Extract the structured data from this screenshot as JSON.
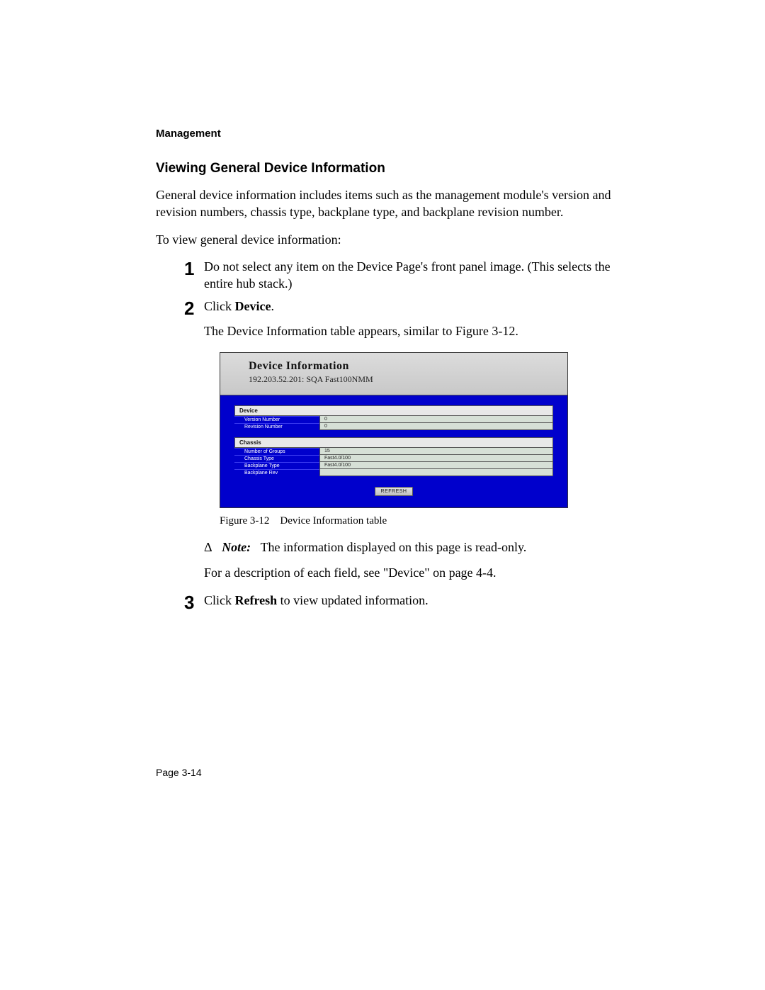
{
  "chapter_label": "Management",
  "section_title": "Viewing General Device Information",
  "intro": "General device information includes items such as the management module's version and revision numbers, chassis type, backplane type, and backplane revision number.",
  "lead": "To view general device information:",
  "steps": {
    "s1": {
      "num": "1",
      "text": "Do not select any item on the Device Page's front panel image. (This selects the entire hub stack.)"
    },
    "s2": {
      "num": "2",
      "pre": "Click ",
      "bold": "Device",
      "post": ".",
      "after": "The Device Information table appears, similar to Figure 3-12."
    },
    "s3": {
      "num": "3",
      "pre": "Click ",
      "bold": "Refresh",
      "post": " to view updated information."
    }
  },
  "figure": {
    "title": "Device Information",
    "subtitle": "192.203.52.201: SQA Fast100NMM",
    "device": {
      "header": "Device",
      "rows": [
        {
          "label": "Version Number",
          "value": "0"
        },
        {
          "label": "Revision Number",
          "value": "0"
        }
      ]
    },
    "chassis": {
      "header": "Chassis",
      "rows": [
        {
          "label": "Number of Groups",
          "value": "15"
        },
        {
          "label": "Chassis Type",
          "value": "Fast4.0/100"
        },
        {
          "label": "Backplane Type",
          "value": "Fast4.0/100"
        },
        {
          "label": "Backplane Rev",
          "value": ""
        }
      ]
    },
    "refresh_label": "REFRESH"
  },
  "caption": "Figure 3-12 Device Information table",
  "note": {
    "delta": "Δ",
    "label": "Note:",
    "text": "The information displayed on this page is read-only."
  },
  "crossref": "For a description of each field, see \"Device\" on page 4-4.",
  "page_number": "Page 3-14"
}
